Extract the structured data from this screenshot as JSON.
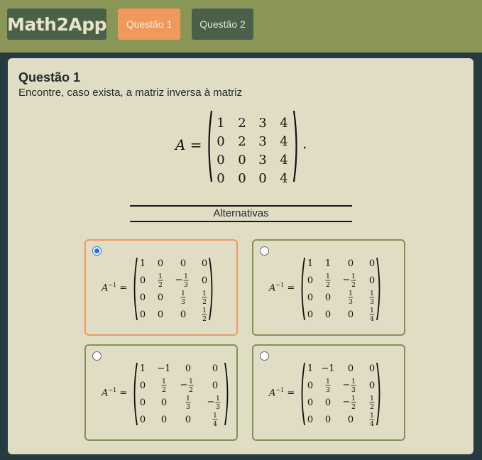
{
  "header": {
    "logo": "Math2App",
    "tabs": [
      {
        "label": "Questão 1",
        "active": true
      },
      {
        "label": "Questão 2",
        "active": false
      }
    ]
  },
  "question": {
    "title": "Questão 1",
    "text": "Encontre, caso exista, a matriz inversa à matriz",
    "lhs": "A =",
    "matrix": [
      [
        "1",
        "2",
        "3",
        "4"
      ],
      [
        "0",
        "2",
        "3",
        "4"
      ],
      [
        "0",
        "0",
        "3",
        "4"
      ],
      [
        "0",
        "0",
        "0",
        "4"
      ]
    ],
    "period": "."
  },
  "alternatives_title": "Alternativas",
  "options": [
    {
      "selected": true,
      "lhs": "A",
      "sup": "−1",
      "eq": "=",
      "matrix": [
        [
          "1",
          "0",
          "0",
          "0"
        ],
        [
          "0",
          "1/2",
          "−1/3",
          "0"
        ],
        [
          "0",
          "0",
          "1/3",
          "1/2"
        ],
        [
          "0",
          "0",
          "0",
          "1/2"
        ]
      ]
    },
    {
      "selected": false,
      "lhs": "A",
      "sup": "−1",
      "eq": "=",
      "matrix": [
        [
          "1",
          "1",
          "0",
          "0"
        ],
        [
          "0",
          "1/2",
          "−1/2",
          "0"
        ],
        [
          "0",
          "0",
          "1/3",
          "1/3"
        ],
        [
          "0",
          "0",
          "0",
          "1/4"
        ]
      ]
    },
    {
      "selected": false,
      "lhs": "A",
      "sup": "−1",
      "eq": "=",
      "matrix": [
        [
          "1",
          "−1",
          "0",
          "0"
        ],
        [
          "0",
          "1/2",
          "−1/2",
          "0"
        ],
        [
          "0",
          "0",
          "1/3",
          "−1/3"
        ],
        [
          "0",
          "0",
          "0",
          "1/4"
        ]
      ]
    },
    {
      "selected": false,
      "lhs": "A",
      "sup": "−1",
      "eq": "=",
      "matrix": [
        [
          "1",
          "−1",
          "0",
          "0"
        ],
        [
          "0",
          "1/3",
          "−1/3",
          "0"
        ],
        [
          "0",
          "0",
          "−1/2",
          "1/2"
        ],
        [
          "0",
          "0",
          "0",
          "1/4"
        ]
      ]
    }
  ]
}
